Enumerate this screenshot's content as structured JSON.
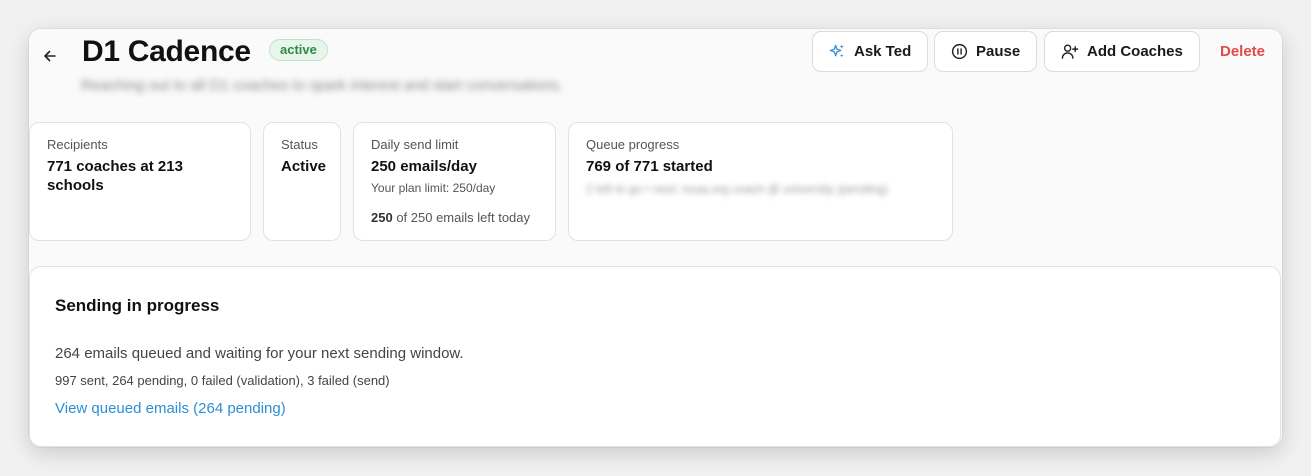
{
  "header": {
    "back_icon": "arrow-left-icon",
    "title": "D1 Cadence",
    "status_badge": "active",
    "subtitle": "Reaching out to all D1 coaches to spark interest and start conversations.",
    "buttons": {
      "ask": {
        "label": "Ask Ted",
        "icon": "sparkle-icon"
      },
      "pause": {
        "label": "Pause",
        "icon": "pause-circle-icon"
      },
      "add": {
        "label": "Add Coaches",
        "icon": "user-plus-icon"
      },
      "delete": {
        "label": "Delete"
      }
    }
  },
  "stats": {
    "recipients": {
      "label": "Recipients",
      "value": "771 coaches at 213 schools"
    },
    "status": {
      "label": "Status",
      "value": "Active"
    },
    "daily_limit": {
      "label": "Daily send limit",
      "value": "250 emails/day",
      "plan_limit": "Your plan limit: 250/day",
      "remaining_count": "250",
      "remaining_suffix": " of 250 emails left today"
    },
    "queue": {
      "label": "Queue progress",
      "value": "769 of 771 started",
      "detail": "2 left to go • next: ncaa.org coach @ university (pending)"
    }
  },
  "progress_panel": {
    "heading": "Sending in progress",
    "message": "264 emails queued and waiting for your next sending window.",
    "counts": "997 sent, 264 pending, 0 failed (validation), 3 failed (send)",
    "link": "View queued emails (264 pending)"
  },
  "colors": {
    "accent_link": "#2b8fd6",
    "delete": "#e04a4a",
    "badge_text": "#2d8a46",
    "badge_bg": "#e7f5ea",
    "sparkle": "#3a8fd4"
  }
}
